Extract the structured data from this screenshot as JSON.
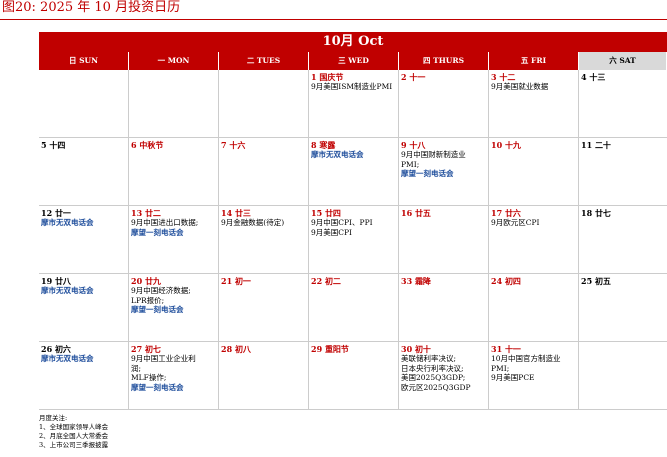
{
  "figure_title": "图20:    2025 年 10 月投资日历",
  "month_label": "10月 Oct",
  "weekdays": [
    "日 SUN",
    "一 MON",
    "二 TUES",
    "三 WED",
    "四 THURS",
    "五 FRI",
    "六 SAT"
  ],
  "weeks": [
    [
      {
        "date": "",
        "lunar": "",
        "date_color": "blk",
        "events": []
      },
      {
        "date": "",
        "lunar": "",
        "date_color": "blk",
        "events": []
      },
      {
        "date": "",
        "lunar": "",
        "date_color": "blk",
        "events": []
      },
      {
        "date": "1",
        "lunar": "国庆节",
        "date_color": "red",
        "events": [
          {
            "text": "9月美国ISM制造业PMI",
            "style": "ev"
          }
        ]
      },
      {
        "date": "2",
        "lunar": "十一",
        "date_color": "red",
        "events": []
      },
      {
        "date": "3",
        "lunar": "十二",
        "date_color": "red",
        "events": [
          {
            "text": "9月美国就业数据",
            "style": "ev"
          }
        ]
      },
      {
        "date": "4",
        "lunar": "十三",
        "date_color": "blk",
        "events": []
      }
    ],
    [
      {
        "date": "5",
        "lunar": "十四",
        "date_color": "blk",
        "events": []
      },
      {
        "date": "6",
        "lunar": "中秋节",
        "date_color": "red",
        "events": []
      },
      {
        "date": "7",
        "lunar": "十六",
        "date_color": "red",
        "events": []
      },
      {
        "date": "8",
        "lunar": "寒露",
        "date_color": "red",
        "events": [
          {
            "text": "摩市无双电话会",
            "style": "ev blue"
          }
        ]
      },
      {
        "date": "9",
        "lunar": "十八",
        "date_color": "red",
        "events": [
          {
            "text": "9月中国财新制造业",
            "style": "ev"
          },
          {
            "text": "PMI;",
            "style": "ev"
          },
          {
            "text": "摩望一刻电话会",
            "style": "ev blue"
          }
        ]
      },
      {
        "date": "10",
        "lunar": "十九",
        "date_color": "red",
        "events": []
      },
      {
        "date": "11",
        "lunar": "二十",
        "date_color": "blk",
        "events": []
      }
    ],
    [
      {
        "date": "12",
        "lunar": "廿一",
        "date_color": "blk",
        "events": [
          {
            "text": "摩市无双电话会",
            "style": "ev blue"
          }
        ]
      },
      {
        "date": "13",
        "lunar": "廿二",
        "date_color": "red",
        "events": [
          {
            "text": "9月中国进出口数据;",
            "style": "ev"
          },
          {
            "text": "摩望一刻电话会",
            "style": "ev blue"
          }
        ]
      },
      {
        "date": "14",
        "lunar": "廿三",
        "date_color": "red",
        "events": [
          {
            "text": "9月金融数据(待定)",
            "style": "ev"
          }
        ]
      },
      {
        "date": "15",
        "lunar": "廿四",
        "date_color": "red",
        "events": [
          {
            "text": "9月中国CPI、PPI",
            "style": "ev"
          },
          {
            "text": "9月美国CPI",
            "style": "ev"
          }
        ]
      },
      {
        "date": "16",
        "lunar": "廿五",
        "date_color": "red",
        "events": []
      },
      {
        "date": "17",
        "lunar": "廿六",
        "date_color": "red",
        "events": [
          {
            "text": "9月欧元区CPI",
            "style": "ev"
          }
        ]
      },
      {
        "date": "18",
        "lunar": "廿七",
        "date_color": "blk",
        "events": []
      }
    ],
    [
      {
        "date": "19",
        "lunar": "廿八",
        "date_color": "blk",
        "events": [
          {
            "text": "摩市无双电话会",
            "style": "ev blue"
          }
        ]
      },
      {
        "date": "20",
        "lunar": "廿九",
        "date_color": "red",
        "events": [
          {
            "text": "9月中国经济数据;",
            "style": "ev"
          },
          {
            "text": "LPR报价;",
            "style": "ev"
          },
          {
            "text": "摩望一刻电话会",
            "style": "ev blue"
          }
        ]
      },
      {
        "date": "21",
        "lunar": "初一",
        "date_color": "red",
        "events": []
      },
      {
        "date": "22",
        "lunar": "初二",
        "date_color": "red",
        "events": []
      },
      {
        "date": "33",
        "lunar": "霜降",
        "date_color": "red",
        "events": []
      },
      {
        "date": "24",
        "lunar": "初四",
        "date_color": "red",
        "events": []
      },
      {
        "date": "25",
        "lunar": "初五",
        "date_color": "blk",
        "events": []
      }
    ],
    [
      {
        "date": "26",
        "lunar": "初六",
        "date_color": "blk",
        "events": [
          {
            "text": "摩市无双电话会",
            "style": "ev blue"
          }
        ]
      },
      {
        "date": "27",
        "lunar": "初七",
        "date_color": "red",
        "events": [
          {
            "text": "9月中国工业企业利",
            "style": "ev"
          },
          {
            "text": "润;",
            "style": "ev"
          },
          {
            "text": "MLF操作;",
            "style": "ev"
          },
          {
            "text": "摩望一刻电话会",
            "style": "ev blue"
          }
        ]
      },
      {
        "date": "28",
        "lunar": "初八",
        "date_color": "red",
        "events": []
      },
      {
        "date": "29",
        "lunar": "重阳节",
        "date_color": "red",
        "events": []
      },
      {
        "date": "30",
        "lunar": "初十",
        "date_color": "red",
        "events": [
          {
            "text": "美联储利率决议;",
            "style": "ev"
          },
          {
            "text": "日本央行利率决议;",
            "style": "ev"
          },
          {
            "text": "美国2025Q3GDP;",
            "style": "ev"
          },
          {
            "text": "欧元区2025Q3GDP",
            "style": "ev"
          }
        ]
      },
      {
        "date": "31",
        "lunar": "十一",
        "date_color": "red",
        "events": [
          {
            "text": "10月中国官方制造业",
            "style": "ev"
          },
          {
            "text": "PMI;",
            "style": "ev"
          },
          {
            "text": "9月美国PCE",
            "style": "ev"
          }
        ]
      },
      {
        "date": "",
        "lunar": "",
        "date_color": "blk",
        "events": []
      }
    ]
  ],
  "notes": [
    "月度关注:",
    "1、全球国家领导人峰会",
    "2、月底全国人大常委会",
    "3、上市公司三季报披露"
  ]
}
